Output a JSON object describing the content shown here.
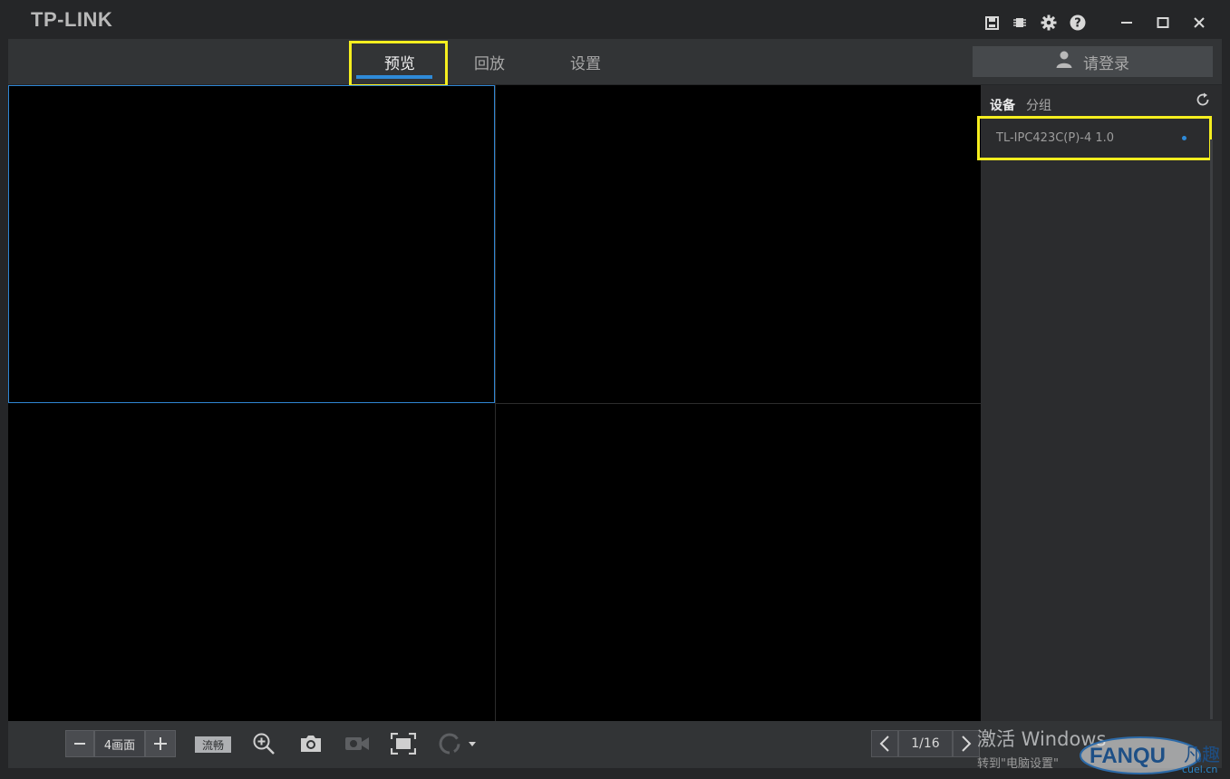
{
  "app": {
    "logo": "TP-LINK"
  },
  "titlebar": {
    "icons": [
      "save-icon",
      "cpu-icon",
      "gear-icon",
      "help-icon",
      "minimize-icon",
      "maximize-icon",
      "close-icon"
    ]
  },
  "nav": {
    "tabs": [
      {
        "label": "预览",
        "active": true
      },
      {
        "label": "回放",
        "active": false
      },
      {
        "label": "设置",
        "active": false
      }
    ],
    "login_label": "请登录"
  },
  "panel": {
    "tab_device": "设备",
    "tab_group": "分组",
    "devices": [
      {
        "name": "TL-IPC423C(P)-4 1.0",
        "status_color": "#2e8ad8"
      }
    ]
  },
  "toolbar": {
    "split_minus": "−",
    "split_label": "4画面",
    "split_plus": "+",
    "stream_label": "流畅",
    "page_label": "1/16"
  },
  "watermark": {
    "line1": "激活 Windows",
    "line2": "转到\"电脑设置\"",
    "brand": "FANQU",
    "brand_cn": "凡趣",
    "brand_site": "cuel.cn"
  },
  "colors": {
    "accent": "#2e8ad8",
    "highlight": "#f5ee1f"
  }
}
